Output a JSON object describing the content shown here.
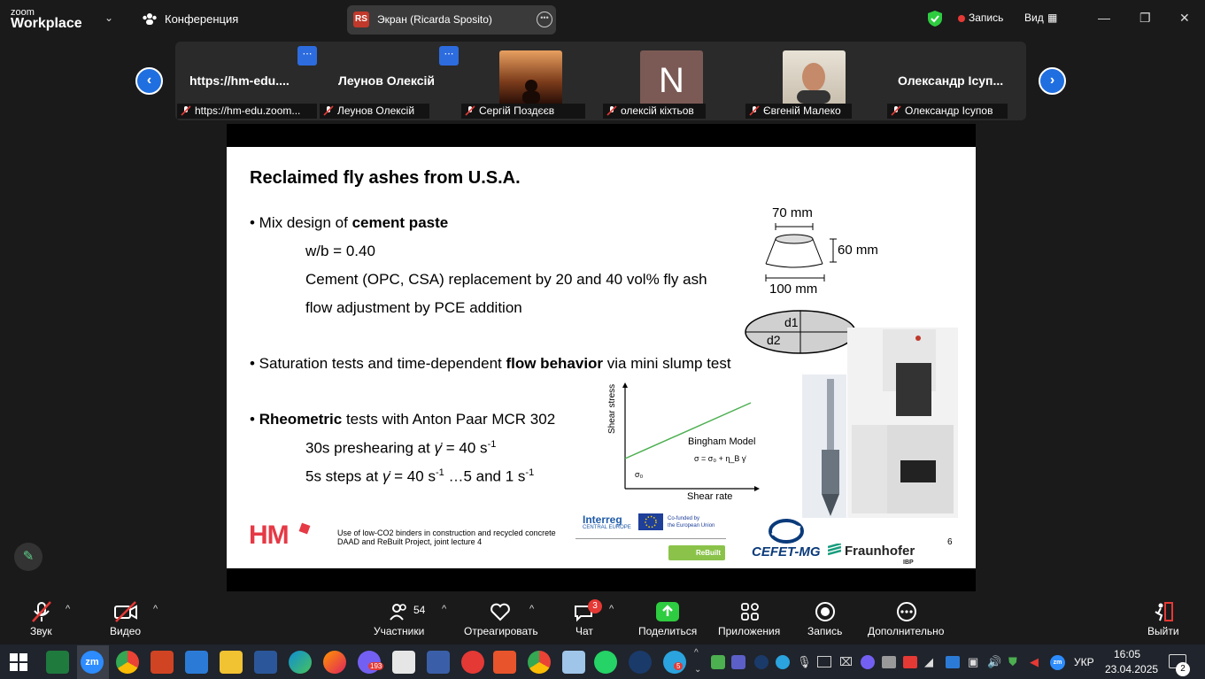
{
  "topbar": {
    "brand_small": "zoom",
    "brand_big": "Workplace",
    "conference_label": "Конференция",
    "screen_avatar": "RS",
    "screen_label": "Экран (Ricarda Sposito)",
    "record_label": "Запись",
    "view_label": "Вид"
  },
  "participants": [
    {
      "name": "https://hm-edu....",
      "label": "https://hm-edu.zoom..."
    },
    {
      "name": "Леунов Олексій",
      "label": "Леунов Олексій"
    },
    {
      "name": "",
      "label": "Сергій Поздєєв"
    },
    {
      "name": "N",
      "label": "олексій кіхтьов"
    },
    {
      "name": "",
      "label": "Євгеній Малеко"
    },
    {
      "name": "Олександр Ісуп...",
      "label": "Олександр Ісупов"
    }
  ],
  "slide": {
    "title": "Reclaimed fly ashes from U.S.A.",
    "b1_pre": "• Mix design of ",
    "b1_bold": "cement paste",
    "b1_l1": "w/b = 0.40",
    "b1_l2": "Cement (OPC, CSA) replacement by 20 and 40 vol% fly ash",
    "b1_l3": "flow adjustment by PCE addition",
    "b2_pre": "• Saturation tests and time-dependent ",
    "b2_bold": "flow behavior",
    "b2_post": " via mini slump test",
    "b3_pre": "• ",
    "b3_bold": "Rheometric",
    "b3_post": " tests with Anton Paar MCR 302",
    "b3_l1a": "30s preshearing at ",
    "b3_l1b": " = 40 s",
    "b3_l2a": "5s steps at ",
    "b3_l2b": " = 40 s",
    "b3_l2c": " …5 and 1 s",
    "gamma": "γ̇",
    "sup": "-1",
    "dim_top": "70 mm",
    "dim_side": "60 mm",
    "dim_bottom": "100 mm",
    "d1": "d1",
    "d2": "d2",
    "chart_y": "Shear stress",
    "chart_x": "Shear rate",
    "chart_model": "Bingham Model",
    "chart_formula": "σ = σ₀ + η_B γ̇",
    "chart_sigma0": "σ₀",
    "footer_logo": "HM",
    "footer_line1": "Use of low-CO2 binders in construction and recycled concrete",
    "footer_line2": "DAAD and ReBuilt Project, joint lecture 4",
    "interreg": "Interreg",
    "interreg_sub": "CENTRAL EUROPE",
    "eu_text1": "Co-funded by",
    "eu_text2": "the European Union",
    "rebuilt": "ReBuilt",
    "cefet": "CEFET-MG",
    "fraunhofer": "Fraunhofer",
    "ibp": "IBP",
    "page": "6"
  },
  "toolbar": {
    "audio": "Звук",
    "video": "Видео",
    "participants": "Участники",
    "participants_count": "54",
    "react": "Отреагировать",
    "chat": "Чат",
    "chat_badge": "3",
    "share": "Поделиться",
    "apps": "Приложения",
    "record": "Запись",
    "more": "Дополнительно",
    "leave": "Выйти"
  },
  "taskbar": {
    "time": "16:05",
    "date": "23.04.2025",
    "lang": "УКР",
    "viber_badge": "193",
    "telegram_badge": "5",
    "notif_badge": "2",
    "zoom_label": "zm"
  },
  "colors": {
    "accent_blue": "#1f6fe0",
    "record_red": "#e53935",
    "share_green": "#2ecc40",
    "chart_green": "#4caf50"
  }
}
